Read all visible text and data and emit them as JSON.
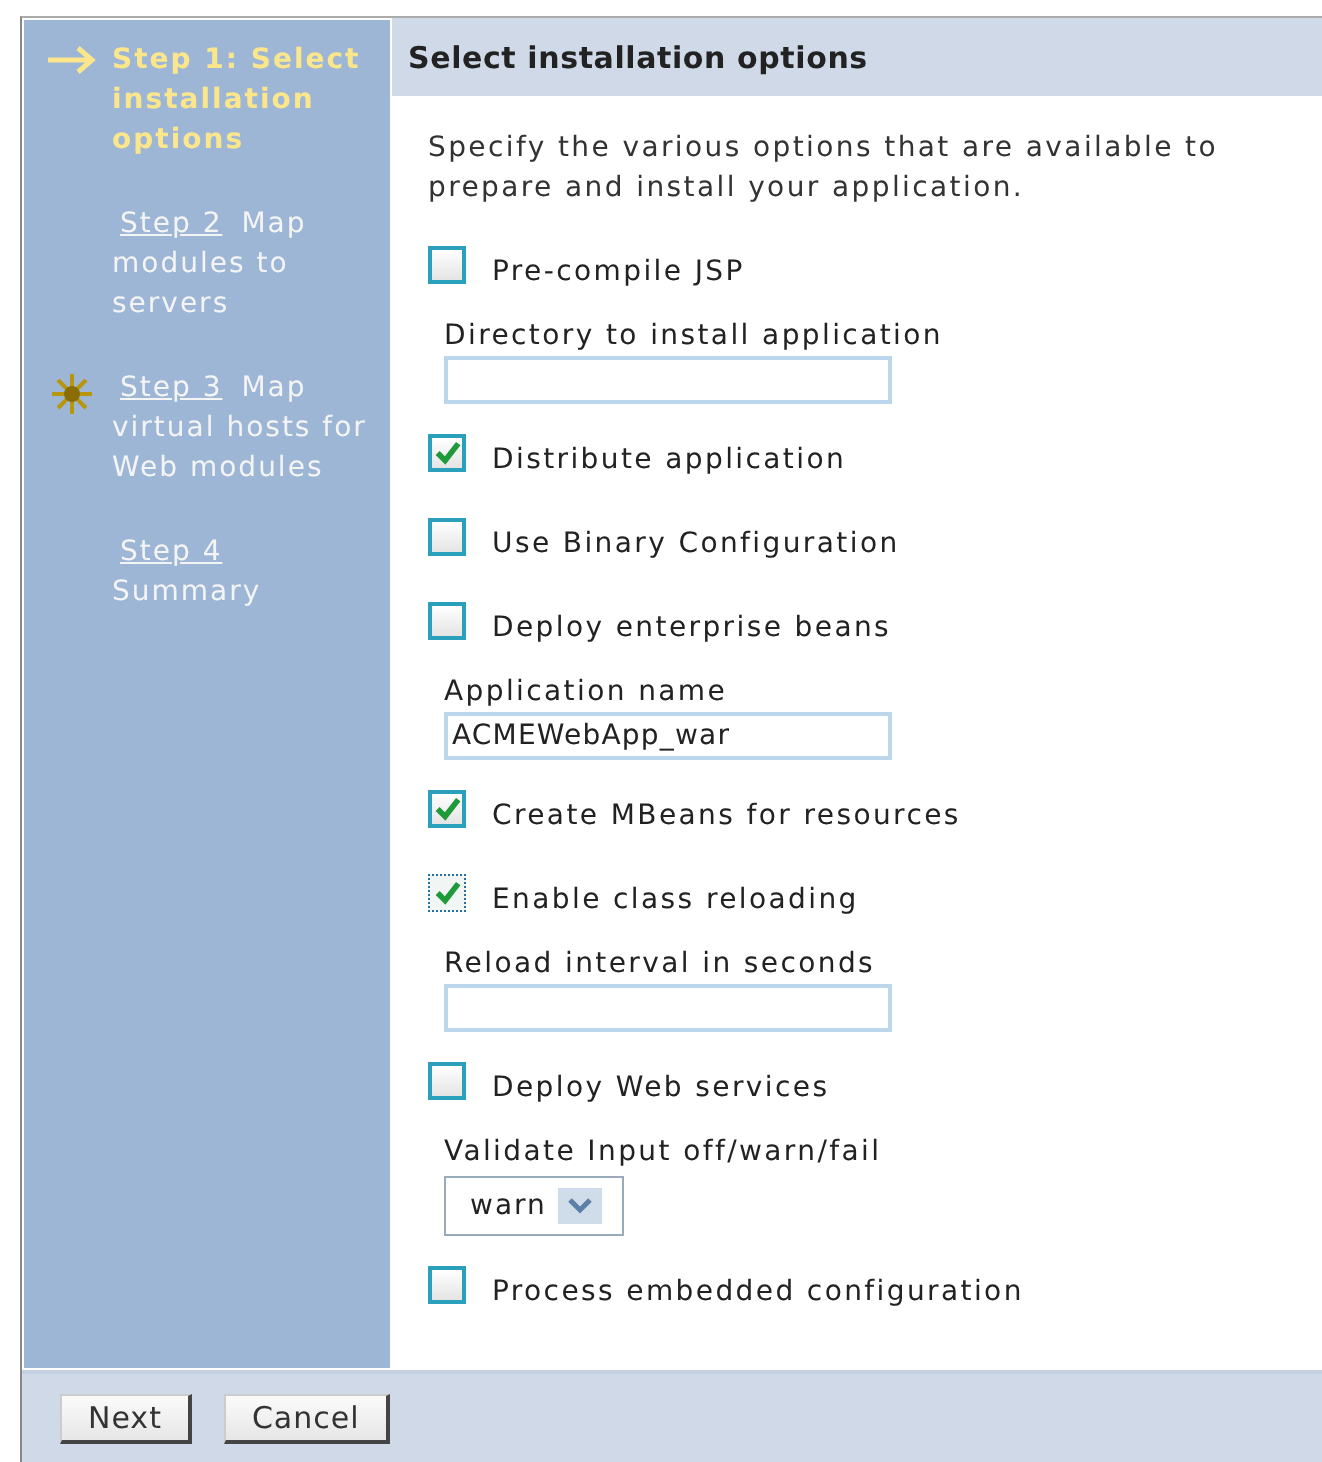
{
  "steps": [
    {
      "kind": "current",
      "selected": true,
      "link": "Step 1: Select installation options"
    },
    {
      "kind": "plain",
      "selected": false,
      "link": "Step 2",
      "text": "Map modules to servers"
    },
    {
      "kind": "attention",
      "selected": false,
      "link": "Step 3",
      "text": "Map virtual hosts for Web modules"
    },
    {
      "kind": "plain",
      "selected": false,
      "link": "Step 4",
      "text": "Summary"
    }
  ],
  "title": "Select installation options",
  "intro": "Specify the various options that are available to prepare and install your application.",
  "options": [
    {
      "kind": "checkbox",
      "label": "Pre-compile JSP",
      "checked": false,
      "focused": false
    },
    {
      "kind": "text",
      "label": "Directory to install application"
    },
    {
      "kind": "checkbox",
      "label": "Distribute application",
      "checked": true,
      "focused": false
    },
    {
      "kind": "checkbox",
      "label": "Use Binary Configuration",
      "checked": false,
      "focused": false
    },
    {
      "kind": "checkbox",
      "label": "Deploy enterprise beans",
      "checked": false,
      "focused": false
    },
    {
      "kind": "text",
      "label": "Application name",
      "value": "ACMEWebApp_war"
    },
    {
      "kind": "checkbox",
      "label": "Create MBeans for resources",
      "checked": true,
      "focused": false
    },
    {
      "kind": "checkbox",
      "label": "Enable class reloading",
      "checked": true,
      "focused": true
    },
    {
      "kind": "text",
      "label": "Reload interval in seconds"
    },
    {
      "kind": "checkbox",
      "label": "Deploy Web services",
      "checked": false,
      "focused": false
    },
    {
      "kind": "select",
      "label": "Validate Input off/warn/fail",
      "value": "warn"
    },
    {
      "kind": "checkbox",
      "label": "Process embedded configuration",
      "checked": false,
      "focused": false
    }
  ],
  "buttons": [
    "Next",
    "Cancel"
  ]
}
